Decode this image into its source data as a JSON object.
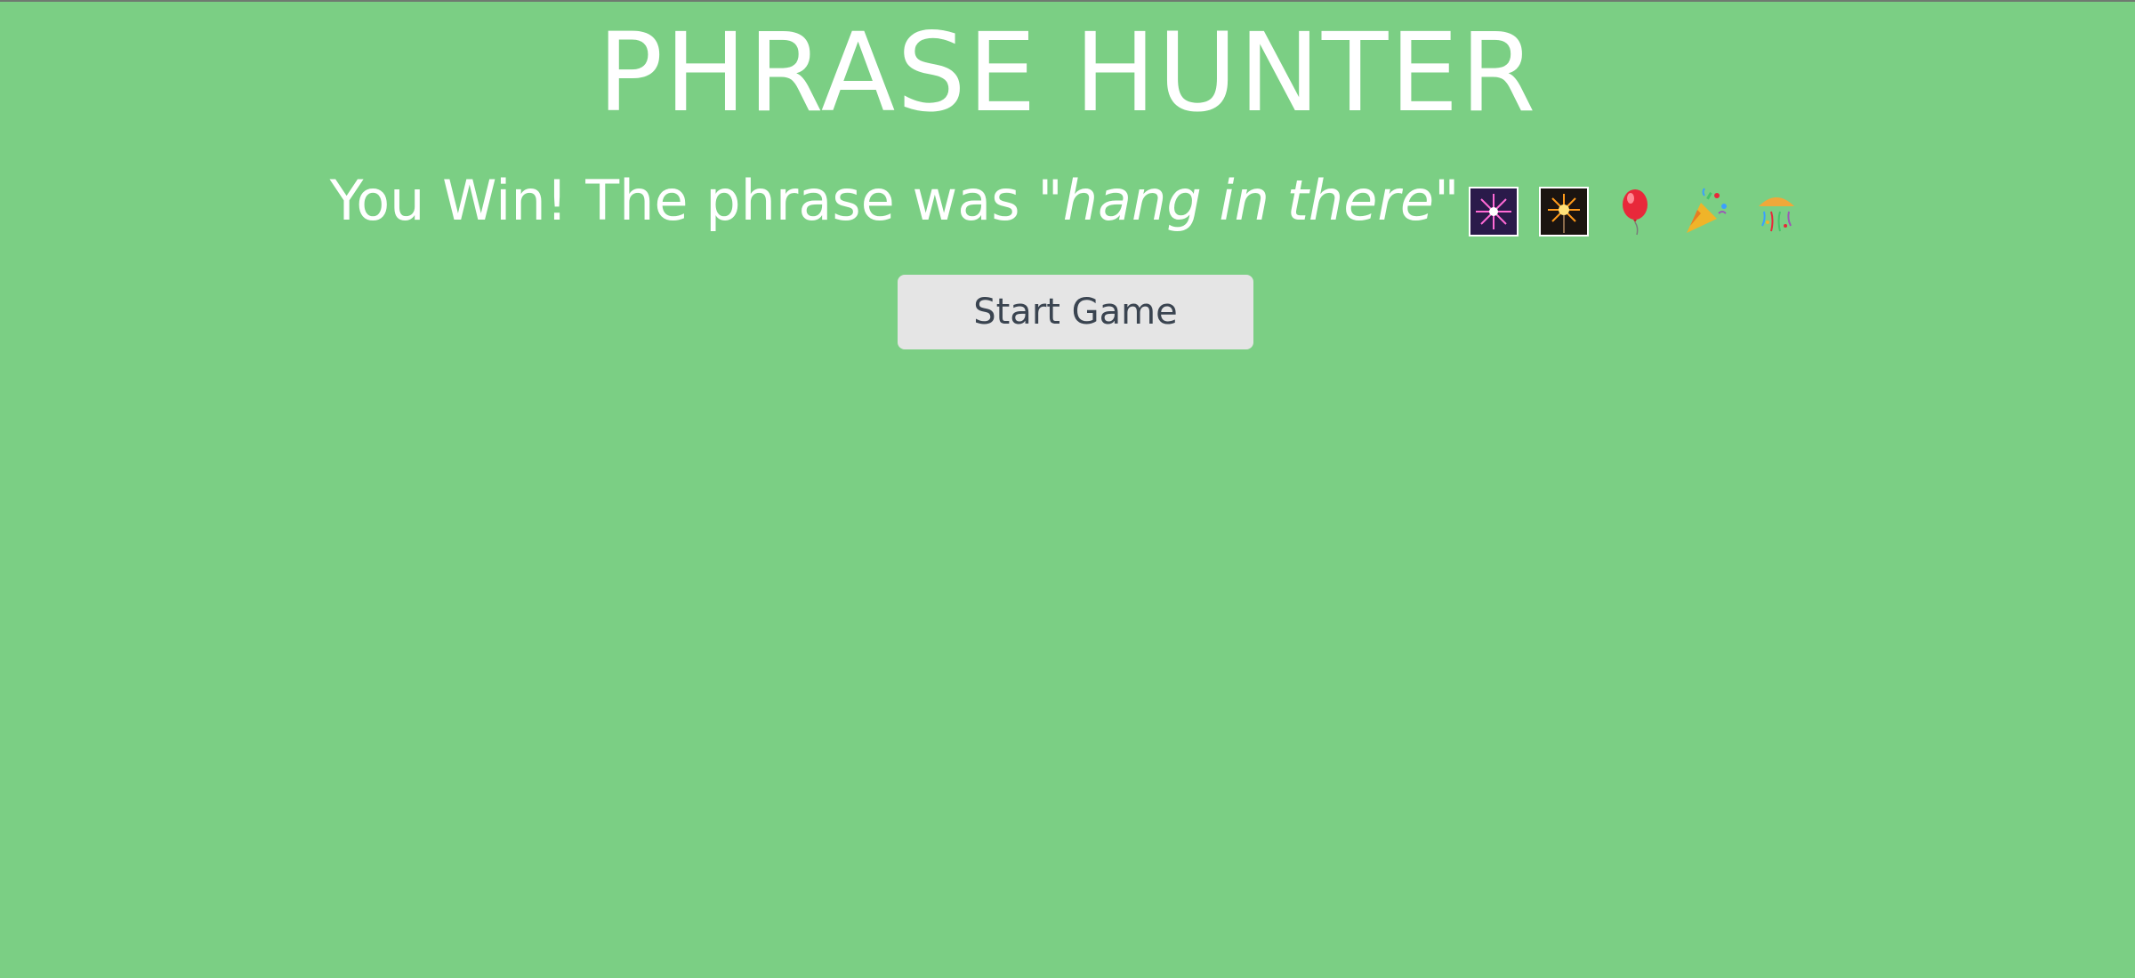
{
  "header": {
    "title": "PHRASE HUNTER"
  },
  "overlay": {
    "message_prefix": "You Win! The phrase was ",
    "phrase": "\"hang in there\"",
    "emojis": [
      "fireworks-icon",
      "sparkler-icon",
      "balloon-icon",
      "party-popper-icon",
      "confetti-ball-icon"
    ],
    "start_label": "Start Game"
  },
  "colors": {
    "background": "#7bcf84",
    "text": "#ffffff",
    "button_bg": "#e5e5e5",
    "button_text": "#3a4450"
  }
}
